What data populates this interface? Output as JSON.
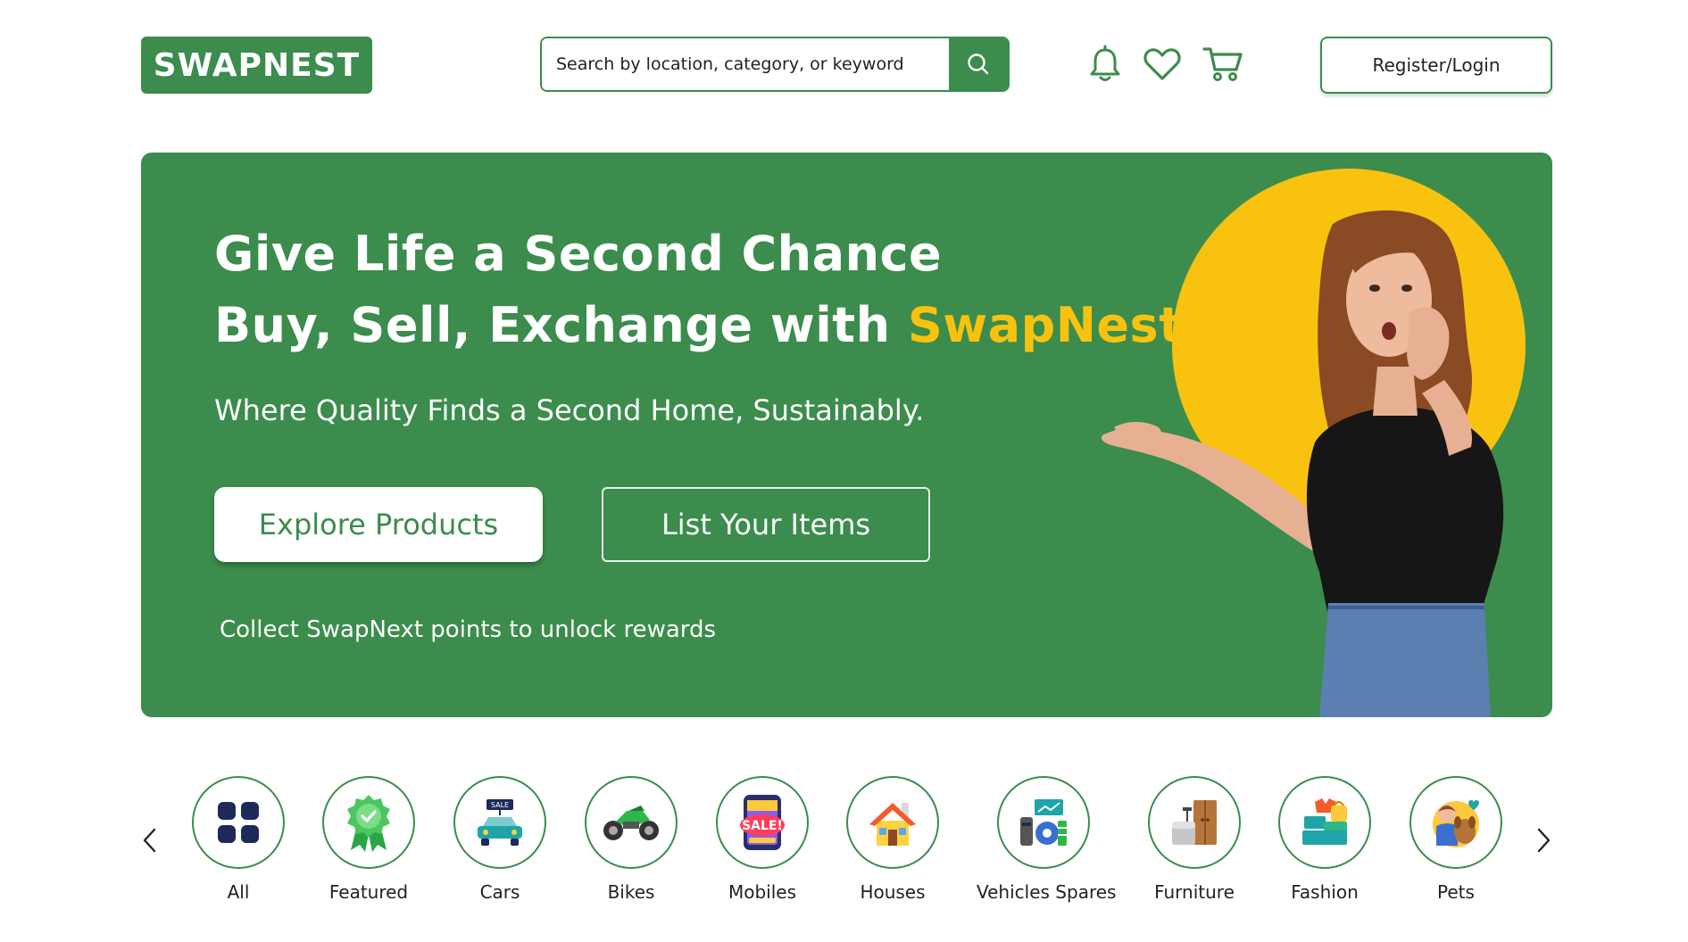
{
  "header": {
    "logo": "SWAPNEST",
    "search_placeholder": "Search by location, category, or keyword",
    "auth_label": "Register/Login",
    "icons": [
      "search-icon",
      "bell-icon",
      "heart-icon",
      "cart-icon"
    ]
  },
  "hero": {
    "headline_line1": "Give Life a Second Chance",
    "headline_line2_prefix": "Buy, Sell, Exchange with ",
    "headline_line2_accent": "SwapNest",
    "headline_line2_suffix": "!",
    "subtitle": "Where Quality Finds a Second Home, Sustainably.",
    "explore_label": "Explore Products",
    "list_label": "List Your Items",
    "rewards_text": "Collect SwapNext points to unlock rewards"
  },
  "categories": [
    {
      "label": "All",
      "icon": "grid-icon"
    },
    {
      "label": "Featured",
      "icon": "badge-icon"
    },
    {
      "label": "Cars",
      "icon": "car-icon"
    },
    {
      "label": "Bikes",
      "icon": "motorbike-icon"
    },
    {
      "label": "Mobiles",
      "icon": "phone-sale-icon"
    },
    {
      "label": "Houses",
      "icon": "house-icon"
    },
    {
      "label": "Vehicles Spares",
      "icon": "spares-icon"
    },
    {
      "label": "Furniture",
      "icon": "furniture-icon"
    },
    {
      "label": "Fashion",
      "icon": "fashion-icon"
    },
    {
      "label": "Pets",
      "icon": "pets-icon"
    }
  ],
  "colors": {
    "brand_green": "#3b8c4d",
    "accent_yellow": "#f8c20f",
    "white": "#ffffff"
  }
}
